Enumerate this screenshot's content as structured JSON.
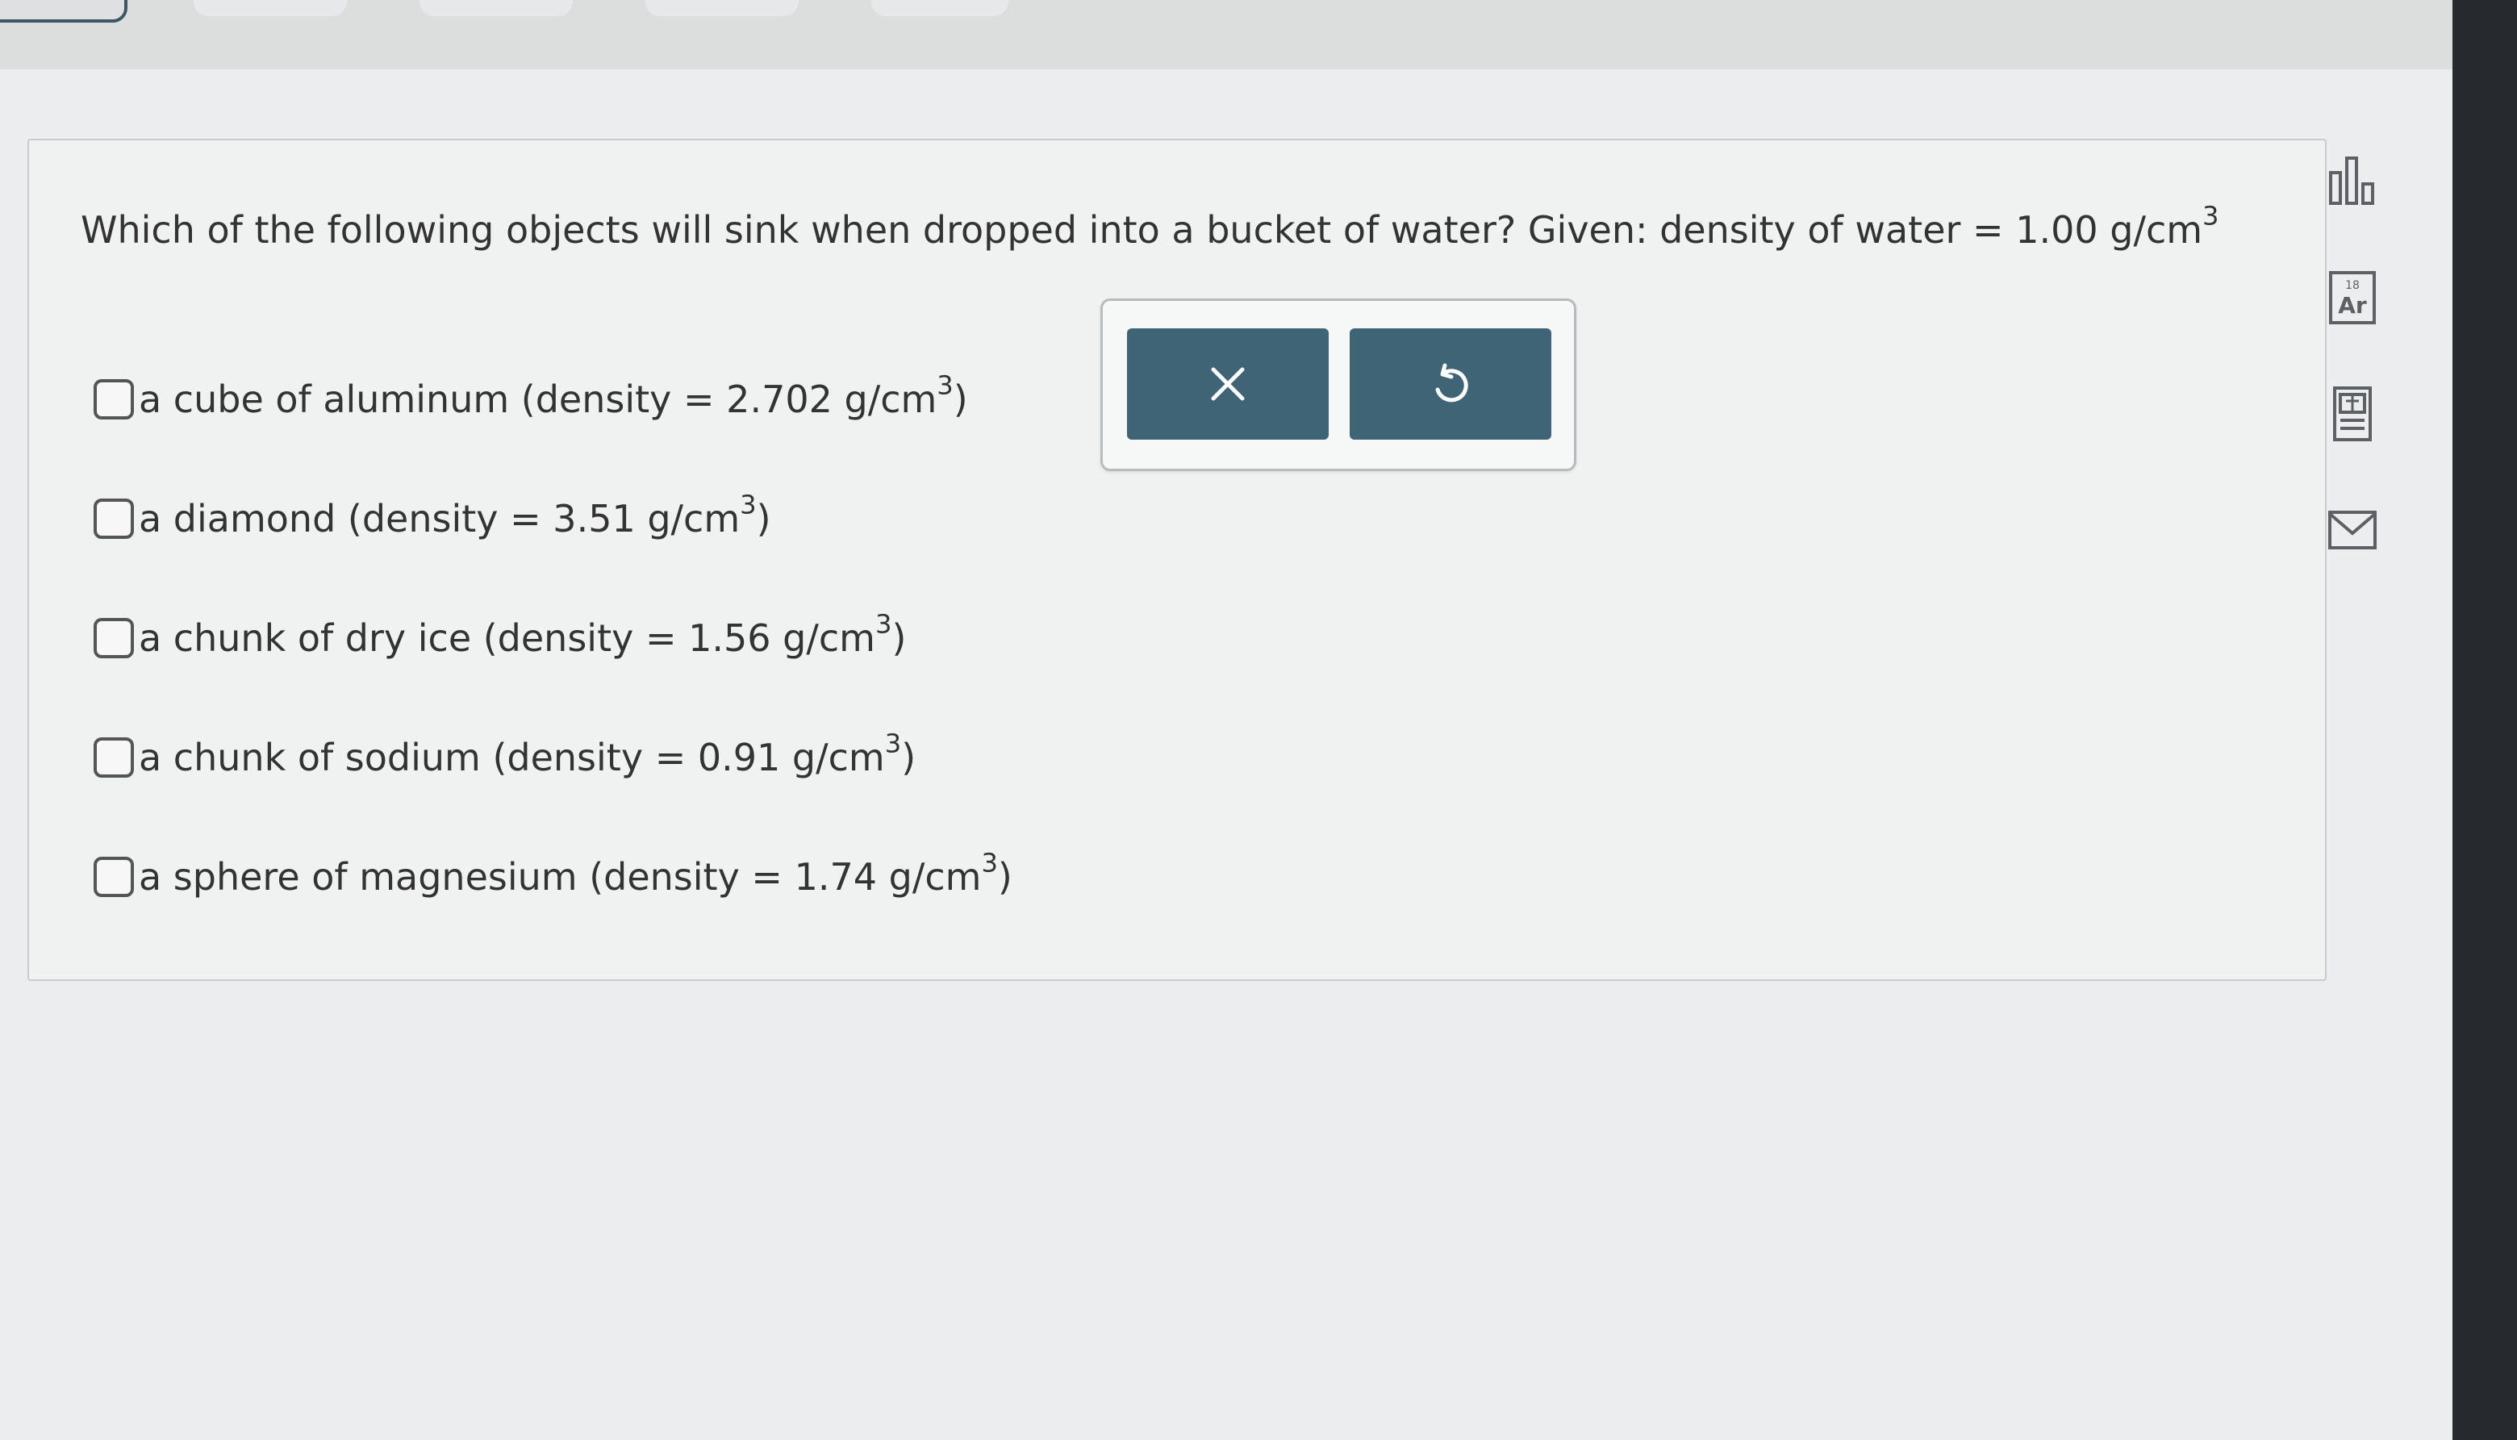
{
  "question": {
    "prefix": "Which of the following objects will sink when dropped into a bucket of water? Given: density of water = 1.00 g/cm",
    "exponent": "3"
  },
  "options": [
    {
      "label": "a cube of aluminum (density = 2.702 g/cm",
      "exponent": "3",
      "suffix": ")",
      "checked": false
    },
    {
      "label": "a diamond (density = 3.51 g/cm",
      "exponent": "3",
      "suffix": ")",
      "checked": false
    },
    {
      "label": "a chunk of dry ice (density = 1.56 g/cm",
      "exponent": "3",
      "suffix": ")",
      "checked": false
    },
    {
      "label": "a chunk of sodium (density = 0.91 g/cm",
      "exponent": "3",
      "suffix": ")",
      "checked": false
    },
    {
      "label": "a sphere of magnesium (density = 1.74 g/cm",
      "exponent": "3",
      "suffix": ")",
      "checked": false
    }
  ],
  "actions": {
    "clear_icon": "close-icon",
    "undo_icon": "undo-icon"
  },
  "side_tools": [
    {
      "icon": "bar-chart-icon"
    },
    {
      "icon": "periodic-table-icon",
      "text": "Ar",
      "number": "18"
    },
    {
      "icon": "calculator-icon"
    },
    {
      "icon": "mail-icon"
    }
  ],
  "colors": {
    "button": "#3e6475",
    "card_background": "#f0f1f1",
    "icon_gray": "#5d6163"
  }
}
